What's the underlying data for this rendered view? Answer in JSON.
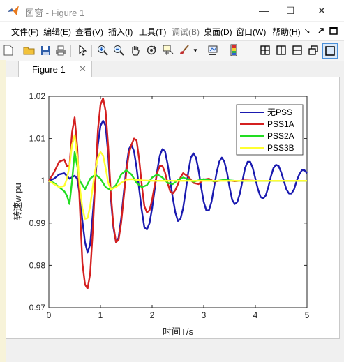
{
  "window": {
    "title": "图窗 - Figure 1",
    "minimize_glyph": "—",
    "maximize_glyph": "☐",
    "close_glyph": "✕"
  },
  "menubar": {
    "items": [
      "文件(F)",
      "编辑(E)",
      "查看(V)",
      "插入(I)",
      "工具(T)",
      "调试(B)",
      "桌面(D)",
      "窗口(W)",
      "帮助(H)"
    ],
    "overflow_glyph": "↘"
  },
  "tab": {
    "label": "Figure 1",
    "close_glyph": "✕"
  },
  "colors": {
    "no_pss": "#1a1ab0",
    "pss1a": "#d42020",
    "pss2a": "#22dd22",
    "pss3b": "#ffff30"
  },
  "chart_data": {
    "type": "line",
    "title": "",
    "xlabel": "时间T/s",
    "ylabel": "转速w pu",
    "xlim": [
      0,
      5
    ],
    "ylim": [
      0.97,
      1.02
    ],
    "xticks": [
      0,
      1,
      2,
      3,
      4,
      5
    ],
    "xtick_labels": [
      "0",
      "1",
      "2",
      "3",
      "4",
      "5"
    ],
    "yticks": [
      0.97,
      0.98,
      0.99,
      1,
      1.01,
      1.02
    ],
    "ytick_labels": [
      "0.97",
      "0.98",
      "0.99",
      "1",
      "1.01",
      "1.02"
    ],
    "grid": false,
    "legend_position": "top-right",
    "series": [
      {
        "name": "无PSS",
        "color": "#1a1ab0",
        "x": [
          0,
          0.1,
          0.2,
          0.3,
          0.4,
          0.5,
          0.55,
          0.6,
          0.65,
          0.7,
          0.75,
          0.8,
          0.85,
          0.9,
          0.95,
          1.0,
          1.05,
          1.1,
          1.15,
          1.2,
          1.25,
          1.3,
          1.35,
          1.4,
          1.45,
          1.5,
          1.55,
          1.6,
          1.65,
          1.7,
          1.75,
          1.8,
          1.85,
          1.9,
          1.95,
          2.0,
          2.05,
          2.1,
          2.15,
          2.2,
          2.25,
          2.3,
          2.35,
          2.4,
          2.45,
          2.5,
          2.55,
          2.6,
          2.65,
          2.7,
          2.75,
          2.8,
          2.85,
          2.9,
          2.95,
          3.0,
          3.05,
          3.1,
          3.15,
          3.2,
          3.25,
          3.3,
          3.35,
          3.4,
          3.45,
          3.5,
          3.55,
          3.6,
          3.65,
          3.7,
          3.75,
          3.8,
          3.85,
          3.9,
          3.95,
          4.0,
          4.05,
          4.1,
          4.15,
          4.2,
          4.25,
          4.3,
          4.35,
          4.4,
          4.45,
          4.5,
          4.55,
          4.6,
          4.65,
          4.7,
          4.75,
          4.8,
          4.85,
          4.9,
          4.95,
          5.0
        ],
        "y": [
          1.0,
          1.0005,
          1.0015,
          1.0018,
          1.0005,
          1.0012,
          1.0005,
          0.9965,
          0.9905,
          0.9855,
          0.983,
          0.985,
          0.992,
          1.0,
          1.0085,
          1.013,
          1.0142,
          1.013,
          1.006,
          0.996,
          0.989,
          0.9855,
          0.9865,
          0.991,
          0.997,
          1.003,
          1.0075,
          1.0085,
          1.007,
          1.003,
          0.998,
          0.993,
          0.989,
          0.9885,
          0.99,
          0.9935,
          0.998,
          1.0025,
          1.006,
          1.0075,
          1.007,
          1.004,
          1.0,
          0.996,
          0.9925,
          0.9905,
          0.991,
          0.9935,
          0.9975,
          1.002,
          1.0055,
          1.0065,
          1.0055,
          1.0025,
          0.9985,
          0.995,
          0.993,
          0.993,
          0.995,
          0.9985,
          1.002,
          1.0045,
          1.0055,
          1.0045,
          1.002,
          0.9985,
          0.9955,
          0.9945,
          0.995,
          0.997,
          1.0,
          1.003,
          1.0045,
          1.0045,
          1.003,
          1.0005,
          0.998,
          0.9962,
          0.9958,
          0.9965,
          0.9985,
          1.001,
          1.003,
          1.0038,
          1.0035,
          1.002,
          1.0,
          0.998,
          0.997,
          0.997,
          0.998,
          1.0,
          1.0015,
          1.0025,
          1.0025,
          1.0018
        ]
      },
      {
        "name": "PSS1A",
        "color": "#d42020",
        "x": [
          0,
          0.1,
          0.2,
          0.3,
          0.35,
          0.4,
          0.45,
          0.5,
          0.55,
          0.6,
          0.65,
          0.7,
          0.75,
          0.8,
          0.85,
          0.9,
          0.95,
          1.0,
          1.05,
          1.1,
          1.15,
          1.2,
          1.25,
          1.3,
          1.35,
          1.4,
          1.45,
          1.5,
          1.55,
          1.6,
          1.65,
          1.7,
          1.75,
          1.8,
          1.85,
          1.9,
          1.95,
          2.0,
          2.05,
          2.1,
          2.15,
          2.2,
          2.25,
          2.3,
          2.35,
          2.4,
          2.45,
          2.5,
          2.55,
          2.6,
          2.7,
          2.8,
          2.9,
          3.0,
          3.1,
          3.2,
          3.4,
          3.6,
          3.8,
          4.0,
          4.5,
          5.0
        ],
        "y": [
          1.0,
          1.002,
          1.0045,
          1.005,
          1.0035,
          1.0035,
          1.0115,
          1.015,
          1.008,
          0.994,
          0.9805,
          0.9755,
          0.9745,
          0.978,
          0.988,
          1.0005,
          1.012,
          1.018,
          1.0195,
          1.0165,
          1.008,
          0.997,
          0.9895,
          0.9855,
          0.986,
          0.99,
          0.996,
          1.002,
          1.0065,
          1.0085,
          1.01,
          1.0095,
          1.005,
          0.999,
          0.994,
          0.9925,
          0.993,
          0.9955,
          0.999,
          1.002,
          1.0035,
          1.0035,
          1.002,
          0.9995,
          0.9975,
          0.997,
          0.9978,
          0.9992,
          1.0008,
          1.0018,
          1.001,
          0.9995,
          0.9992,
          1.0003,
          1.0005,
          0.9998,
          1.0002,
          0.9999,
          1.0001,
          1.0,
          1.0,
          1.0
        ]
      },
      {
        "name": "PSS2A",
        "color": "#22dd22",
        "x": [
          0,
          0.1,
          0.2,
          0.3,
          0.35,
          0.4,
          0.45,
          0.5,
          0.55,
          0.6,
          0.7,
          0.8,
          0.9,
          1.0,
          1.1,
          1.2,
          1.3,
          1.4,
          1.5,
          1.6,
          1.7,
          1.8,
          1.9,
          2.0,
          2.1,
          2.2,
          2.3,
          2.4,
          2.5,
          2.6,
          2.8,
          3.0,
          3.2,
          3.4,
          3.6,
          4.0,
          4.5,
          5.0
        ],
        "y": [
          1.0,
          0.9995,
          0.9985,
          0.9975,
          0.9965,
          0.9945,
          1.0,
          1.0068,
          1.0035,
          1.0,
          0.998,
          1.0005,
          1.0015,
          1.0005,
          0.9985,
          0.9978,
          0.999,
          1.0015,
          1.0025,
          1.0015,
          0.9995,
          0.9985,
          0.999,
          1.0008,
          1.0015,
          1.0008,
          0.9995,
          0.9992,
          1.0002,
          1.0008,
          0.9998,
          1.0004,
          0.9999,
          1.0002,
          1.0,
          1.0,
          1.0,
          1.0
        ]
      },
      {
        "name": "PSS3B",
        "color": "#ffff30",
        "x": [
          0,
          0.1,
          0.2,
          0.3,
          0.35,
          0.4,
          0.45,
          0.5,
          0.55,
          0.6,
          0.65,
          0.7,
          0.75,
          0.8,
          0.85,
          0.9,
          0.95,
          1.0,
          1.05,
          1.1,
          1.15,
          1.2,
          1.3,
          1.4,
          1.5,
          1.6,
          1.8,
          2.0,
          2.5,
          3.0,
          4.0,
          5.0
        ],
        "y": [
          1.0,
          0.9992,
          0.9985,
          0.9988,
          1.0005,
          1.0035,
          1.0085,
          1.0108,
          1.006,
          0.9985,
          0.9935,
          0.991,
          0.9912,
          0.994,
          0.9985,
          1.0025,
          1.0055,
          1.0068,
          1.006,
          1.003,
          0.9995,
          0.998,
          0.9985,
          0.9995,
          1.0003,
          1.0004,
          1.0001,
          1.0,
          1.0,
          1.0,
          1.0,
          1.0
        ]
      }
    ]
  }
}
